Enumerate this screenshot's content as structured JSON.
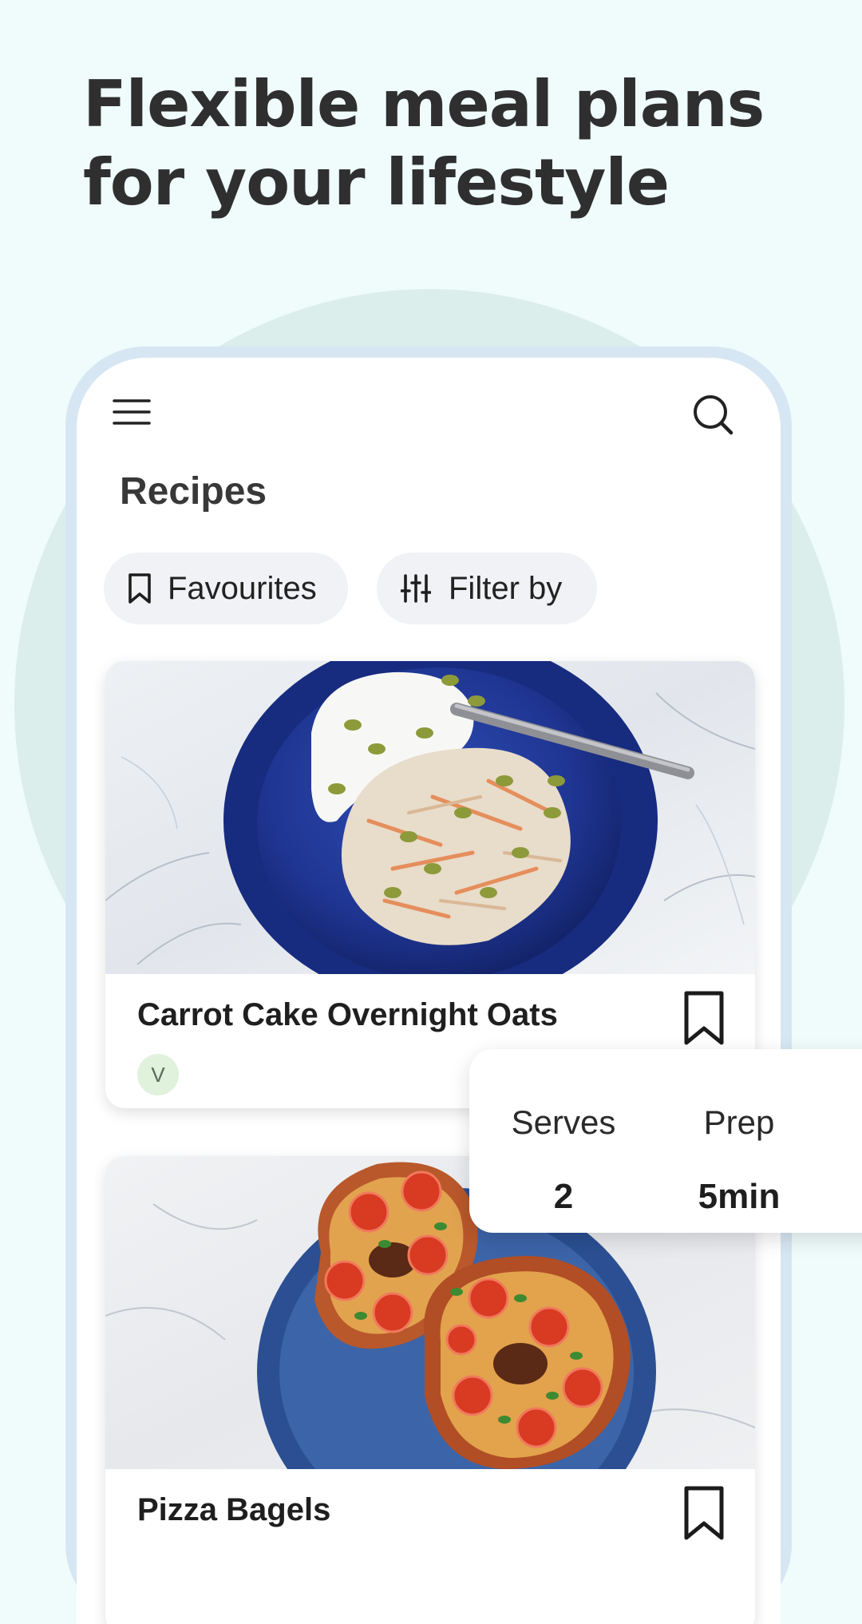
{
  "headline": "Flexible meal plans for your lifestyle",
  "screen": {
    "title": "Recipes",
    "menu_icon": "hamburger-menu-icon",
    "search_icon": "search-icon"
  },
  "filters": {
    "favourites": {
      "label": "Favourites",
      "icon": "bookmark-icon"
    },
    "filter_by": {
      "label": "Filter by",
      "icon": "sliders-icon"
    }
  },
  "recipes": [
    {
      "title": "Carrot Cake Overnight Oats",
      "badge": "V",
      "bookmarked": false
    },
    {
      "title": "Pizza Bagels",
      "bookmarked": false
    }
  ],
  "recipe_info": [
    {
      "label": "Serves",
      "value": "2"
    },
    {
      "label": "Prep",
      "value": "5min"
    },
    {
      "label": "",
      "value": ""
    }
  ],
  "colors": {
    "page_background": "#effcfb",
    "circle": "#dbeeeb",
    "phone_frame": "#d7e6f3",
    "chip_background": "#f0f2f5",
    "badge_background": "#e0f1dc"
  }
}
